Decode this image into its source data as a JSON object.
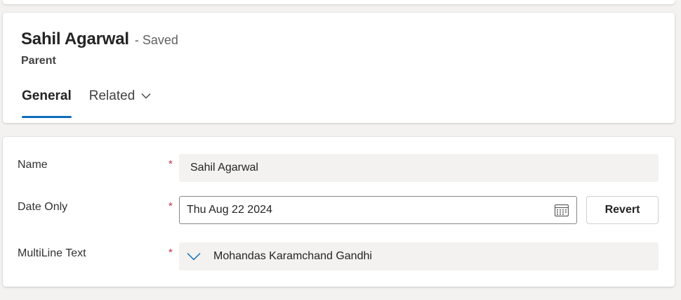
{
  "header": {
    "title": "Sahil Agarwal",
    "save_status": "- Saved",
    "entity": "Parent"
  },
  "tabs": [
    {
      "label": "General",
      "active": true
    },
    {
      "label": "Related",
      "active": false,
      "has_dropdown": true
    }
  ],
  "form": {
    "required_marker": "*",
    "fields": [
      {
        "label": "Name",
        "value": "Sahil Agarwal",
        "required": true
      },
      {
        "label": "Date Only",
        "value": "Thu Aug 22 2024",
        "required": true,
        "icon": "calendar-icon",
        "action_label": "Revert"
      },
      {
        "label": "MultiLine Text",
        "value": "Mohandas Karamchand Gandhi",
        "required": true,
        "icon": "chevron-down-icon"
      }
    ]
  },
  "colors": {
    "accent": "#0f6cbd",
    "required": "#c4314b",
    "field_background": "#f3f2f1"
  }
}
